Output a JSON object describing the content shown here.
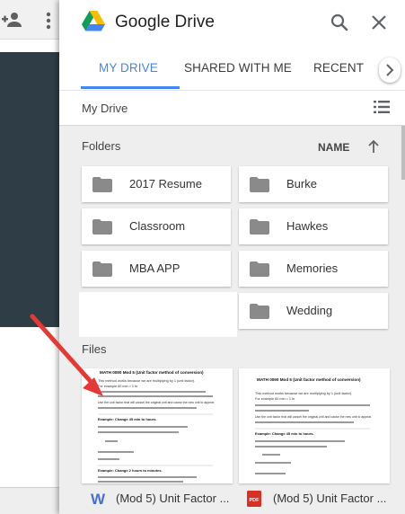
{
  "app": {
    "title": "Google Drive"
  },
  "tabs": [
    {
      "label": "MY DRIVE",
      "active": true
    },
    {
      "label": "SHARED WITH ME",
      "active": false
    },
    {
      "label": "RECENT",
      "active": false
    }
  ],
  "breadcrumb": "My Drive",
  "folders_section": {
    "label": "Folders",
    "sort_label": "NAME",
    "sort_direction": "ascending"
  },
  "folders": [
    {
      "name": "2017 Resume"
    },
    {
      "name": "Burke"
    },
    {
      "name": "Classroom"
    },
    {
      "name": "Hawkes"
    },
    {
      "name": "MBA APP"
    },
    {
      "name": "Memories"
    },
    {
      "name": "Wedding"
    }
  ],
  "files_section": {
    "label": "Files"
  },
  "files": [
    {
      "name": "(Mod 5) Unit Factor ...",
      "type_icon": "word-icon",
      "thumb": {
        "title": "MATH 0090 Mod 5 (Unit factor method of conversion)",
        "line1": "This method works because we are multiplying by 1 (unit factor).",
        "line2": "For example 60 min = 1 hr",
        "line3": "Use the unit factor that will cancel the original unit and cause the new unit to appear.",
        "example1": "Example: Change 45 min to hours.",
        "example2": "Example: Change 2 hours to minutes."
      }
    },
    {
      "name": "(Mod 5) Unit Factor ...",
      "type_icon": "pdf-icon",
      "thumb": {
        "title": "MATH 0090 Mod 5 (Unit factor method of conversion)",
        "line1": "This method works because we are multiplying by 1 (unit factor).",
        "line2": "For example 60 min = 1 hr",
        "line3": "Use the unit factor that will cancel the original unit and cause the new unit to appear.",
        "example1": "Example: Change 45 min to hours.",
        "example2": ""
      }
    }
  ],
  "colors": {
    "accent": "#4285f4",
    "word": "#4a6fd1",
    "pdf": "#d93025",
    "annotation_arrow": "#e53935"
  }
}
